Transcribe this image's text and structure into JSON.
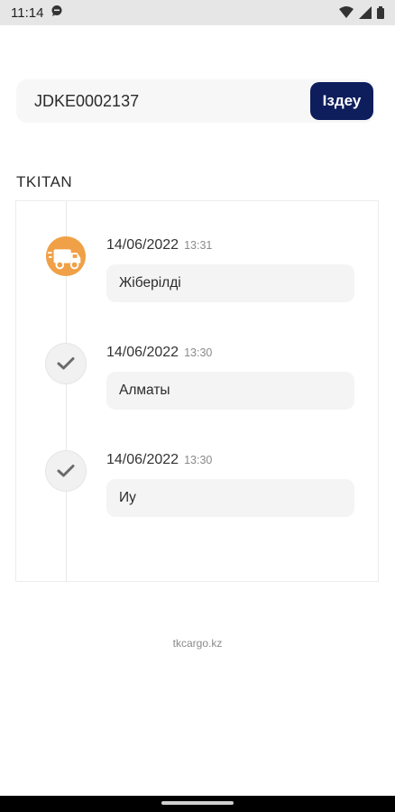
{
  "status_bar": {
    "time": "11:14"
  },
  "search": {
    "value": "JDKE0002137",
    "button_label": "Іздеу"
  },
  "section_title": "TKITAN",
  "events": [
    {
      "date": "14/06/2022",
      "time": "13:31",
      "status": "Жіберілді",
      "icon": "delivery-truck-icon"
    },
    {
      "date": "14/06/2022",
      "time": "13:30",
      "status": "Алматы",
      "icon": "check-icon"
    },
    {
      "date": "14/06/2022",
      "time": "13:30",
      "status": "Иу",
      "icon": "check-icon"
    }
  ],
  "footer": {
    "site": "tkcargo.kz"
  },
  "colors": {
    "accent": "#0e1d5c",
    "truck": "#f0a046",
    "check": "#6a6a6a"
  }
}
